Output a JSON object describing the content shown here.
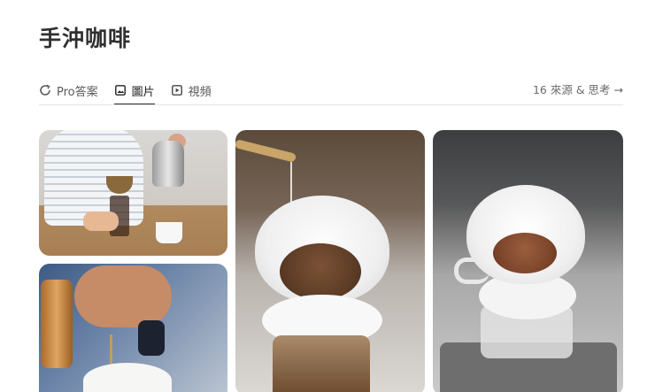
{
  "page": {
    "title": "手沖咖啡"
  },
  "tabs": [
    {
      "label": "Pro答案",
      "icon": "pro-answer-icon"
    },
    {
      "label": "圖片",
      "icon": "image-icon",
      "active": true
    },
    {
      "label": "視頻",
      "icon": "video-icon"
    }
  ],
  "sources": {
    "label": "16 來源 & 思考 →"
  },
  "gallery": {
    "images": [
      {
        "subject": "pour-over-brewing-at-table"
      },
      {
        "subject": "pouring-from-copper-kettle"
      },
      {
        "subject": "v60-dripper-with-grounds"
      },
      {
        "subject": "dripper-on-scale"
      }
    ]
  },
  "colors": {
    "text": "#2b2b2b",
    "muted": "#6b6b6b",
    "divider": "#e6e6e6",
    "active_underline": "#2b2b2b"
  }
}
